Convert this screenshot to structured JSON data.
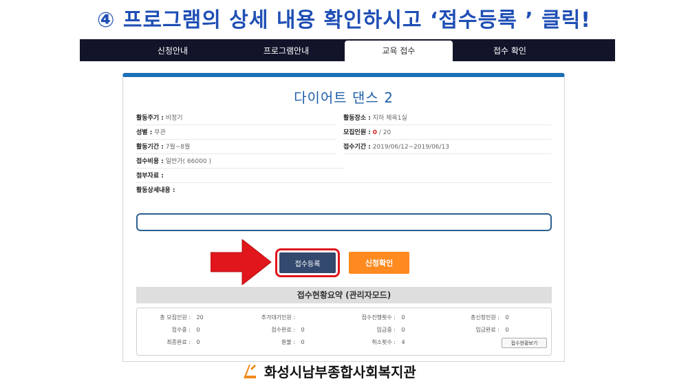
{
  "slide_title": "④ 프로그램의 상세 내용 확인하시고 ‘접수등록 ’ 클릭!",
  "nav": {
    "tabs": [
      {
        "label": "신청안내"
      },
      {
        "label": "프로그램안내"
      },
      {
        "label": "교육 접수"
      },
      {
        "label": "접수 확인"
      }
    ]
  },
  "course": {
    "title": "다이어트 댄스 2",
    "fields": {
      "period_label": "활동주기 :",
      "period_value": "비정기",
      "place_label": "활동장소 :",
      "place_value": "지하 체육1실",
      "gender_label": "성별 :",
      "gender_value": "무관",
      "recruit_label": "모집인원 :",
      "recruit_current": "0",
      "recruit_total": " / 20",
      "duration_label": "활동기간 :",
      "duration_value": "7월~8월",
      "apply_period_label": "접수기간 :",
      "apply_period_value": "2019/06/12~2019/06/13",
      "fee_label": "접수비용 :",
      "fee_value": "일반가( 66000 )",
      "attach_label": "첨부자료 :",
      "detail_label": "활동상세내용 :"
    }
  },
  "buttons": {
    "register": "접수등록",
    "confirm": "신청확인"
  },
  "summary": {
    "title": "접수현황요약 (관리자모드)",
    "rows": [
      [
        {
          "label": "총 모집인원 :",
          "value": "20"
        },
        {
          "label": "추가대기인원 :",
          "value": ""
        },
        {
          "label": "접수진행횟수 :",
          "value": "0"
        },
        {
          "label": "총신청인원 :",
          "value": "0"
        }
      ],
      [
        {
          "label": "접수중 :",
          "value": "0"
        },
        {
          "label": "접수완료 :",
          "value": "0"
        },
        {
          "label": "입금중 :",
          "value": "0"
        },
        {
          "label": "입금완료 :",
          "value": "0"
        }
      ],
      [
        {
          "label": "최종완료 :",
          "value": "0"
        },
        {
          "label": "환불 :",
          "value": "0"
        },
        {
          "label": "취소횟수 :",
          "value": "4"
        }
      ]
    ],
    "view_button": "접수현황보기"
  },
  "footer": {
    "org_name": "화성시남부종합사회복지관"
  },
  "colors": {
    "title_blue": "#1f4fb5",
    "nav_bg": "#12142a",
    "register_btn": "#34496e",
    "confirm_btn": "#ff8a1f",
    "highlight_red": "#e0161c"
  }
}
